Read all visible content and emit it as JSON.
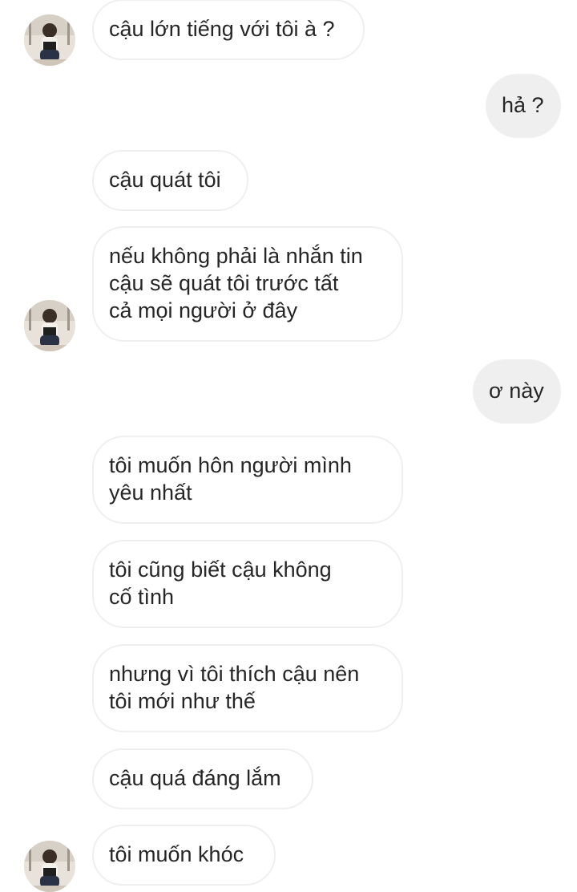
{
  "chat": {
    "messages": [
      {
        "side": "incoming",
        "text": "cậu lớn tiếng với tôi à ?"
      },
      {
        "side": "outgoing",
        "text": "hả ?"
      },
      {
        "side": "incoming",
        "text": "cậu quát tôi"
      },
      {
        "side": "incoming",
        "text": "nếu không phải là nhắn tin\ncậu sẽ quát tôi trước tất\ncả mọi người ở đây"
      },
      {
        "side": "outgoing",
        "text": "ơ này"
      },
      {
        "side": "incoming",
        "text": "tôi muốn hôn người mình\nyêu nhất"
      },
      {
        "side": "incoming",
        "text": "tôi cũng biết cậu không\ncố tình"
      },
      {
        "side": "incoming",
        "text": "nhưng vì tôi thích cậu nên\ntôi mới như thế"
      },
      {
        "side": "incoming",
        "text": "cậu quá đáng lắm"
      },
      {
        "side": "incoming",
        "text": "tôi muốn khóc"
      }
    ]
  },
  "colors": {
    "incoming_bubble_border": "#efefef",
    "outgoing_bubble_bg": "#efefef",
    "text": "#262626"
  },
  "icons": {
    "avatar": "contact-avatar-photo"
  }
}
